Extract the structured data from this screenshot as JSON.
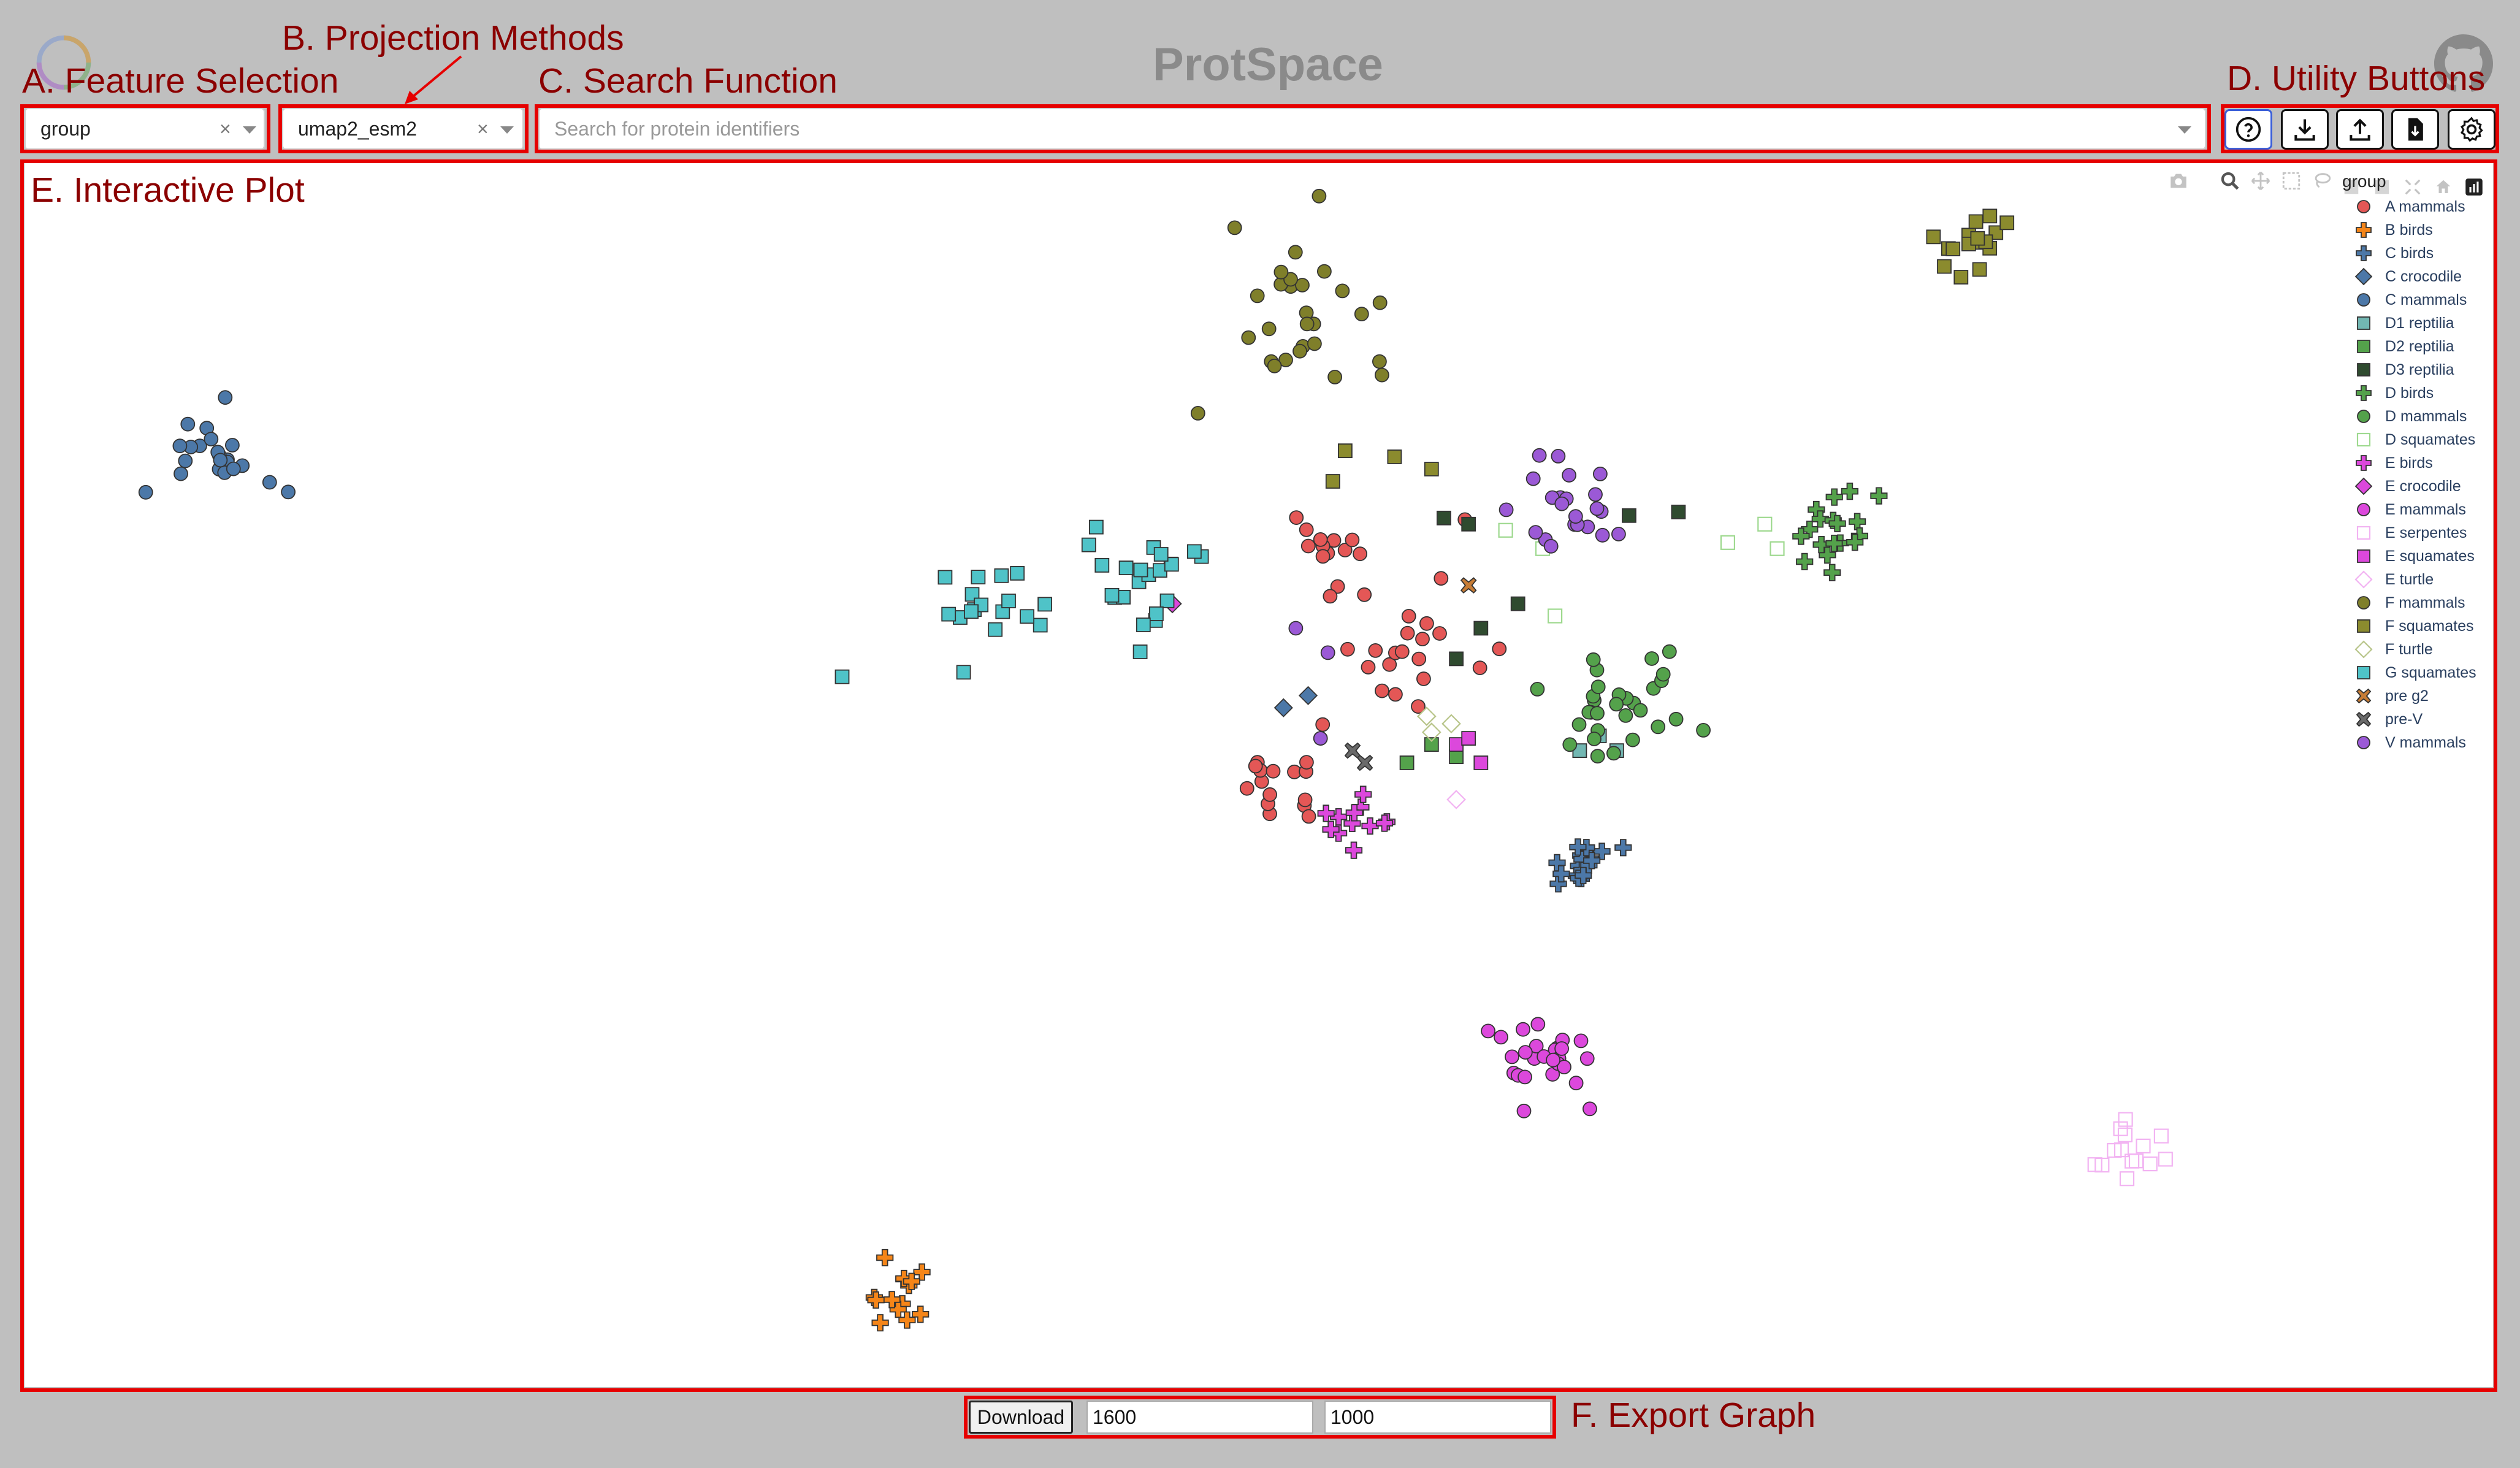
{
  "app_title": "ProtSpace",
  "annotations": {
    "a": "A. Feature Selection",
    "b": "B. Projection Methods",
    "c": "C. Search Function",
    "d": "D. Utility Buttons",
    "e": "E. Interactive Plot",
    "f": "F. Export Graph"
  },
  "feature_select": {
    "value": "group",
    "clear": "×"
  },
  "projection_select": {
    "value": "umap2_esm2",
    "clear": "×"
  },
  "search": {
    "placeholder": "Search for protein identifiers"
  },
  "utility_buttons": [
    "help-icon",
    "download-icon",
    "upload-icon",
    "file-download-icon",
    "gear-icon"
  ],
  "modebar_icons": [
    "camera-icon",
    "zoom-icon",
    "pan-icon",
    "box-select-icon",
    "lasso-icon",
    "zoom-in-icon",
    "zoom-out-icon",
    "autoscale-icon",
    "home-icon",
    "plotly-logo-icon"
  ],
  "export": {
    "button_label": "Download",
    "width": "1600",
    "height": "1000"
  },
  "chart_data": {
    "type": "scatter",
    "legend_title": "group",
    "legend_placement": "top-right",
    "xlim": [
      0,
      100
    ],
    "ylim": [
      0,
      100
    ],
    "series": [
      {
        "name": "A mammals",
        "color": "#e45756",
        "symbol": "circle",
        "fill": true,
        "cluster": [
          [
            53,
            70,
            2.5,
            12
          ],
          [
            56,
            60,
            3,
            22
          ],
          [
            51,
            50,
            2.5,
            16
          ]
        ]
      },
      {
        "name": "B birds",
        "color": "#f58518",
        "symbol": "cross",
        "fill": true,
        "cluster": [
          [
            35.2,
            7,
            1.2,
            14
          ]
        ]
      },
      {
        "name": "C birds",
        "color": "#4c78a8",
        "symbol": "cross",
        "fill": true,
        "cluster": [
          [
            63,
            42.5,
            1.3,
            18
          ]
        ]
      },
      {
        "name": "C crocodile",
        "color": "#4c78a8",
        "symbol": "diamond",
        "fill": true,
        "points": [
          [
            51,
            55.5
          ],
          [
            52,
            56.5
          ]
        ]
      },
      {
        "name": "C mammals",
        "color": "#4c78a8",
        "symbol": "circle",
        "fill": true,
        "cluster": [
          [
            7.5,
            76.5,
            2.5,
            22
          ]
        ]
      },
      {
        "name": "D1 reptilia",
        "color": "#72b7b2",
        "symbol": "square",
        "fill": true,
        "points": [
          [
            63,
            52
          ],
          [
            64.5,
            52
          ],
          [
            63.8,
            53.2
          ]
        ]
      },
      {
        "name": "D2 reptilia",
        "color": "#54a24b",
        "symbol": "square",
        "fill": true,
        "points": [
          [
            56,
            51
          ],
          [
            58,
            51.5
          ],
          [
            57,
            52.5
          ]
        ]
      },
      {
        "name": "D3 reptilia",
        "color": "#2f4b2f",
        "symbol": "square",
        "fill": true,
        "points": [
          [
            57.5,
            71
          ],
          [
            58.5,
            70.5
          ],
          [
            65,
            71.2
          ],
          [
            67,
            71.5
          ],
          [
            59,
            62
          ],
          [
            60.5,
            64
          ],
          [
            58,
            59.5
          ]
        ]
      },
      {
        "name": "D birds",
        "color": "#54a24b",
        "symbol": "cross",
        "fill": true,
        "cluster": [
          [
            73,
            69.5,
            2,
            18
          ]
        ]
      },
      {
        "name": "D mammals",
        "color": "#54a24b",
        "symbol": "circle",
        "fill": true,
        "cluster": [
          [
            65,
            56,
            3,
            30
          ]
        ]
      },
      {
        "name": "D squamates",
        "color": "#9ed98f",
        "symbol": "square",
        "fill": false,
        "points": [
          [
            60,
            70
          ],
          [
            61.5,
            68.5
          ],
          [
            69,
            69
          ],
          [
            70.5,
            70.5
          ],
          [
            71,
            68.5
          ],
          [
            62,
            63
          ]
        ]
      },
      {
        "name": "E birds",
        "color": "#dc48dc",
        "symbol": "cross",
        "fill": true,
        "cluster": [
          [
            54,
            46,
            1.5,
            12
          ]
        ]
      },
      {
        "name": "E crocodile",
        "color": "#dc48dc",
        "symbol": "diamond",
        "fill": true,
        "points": [
          [
            46.5,
            64
          ]
        ]
      },
      {
        "name": "E mammals",
        "color": "#dc48dc",
        "symbol": "circle",
        "fill": true,
        "cluster": [
          [
            61.5,
            27,
            2,
            26
          ]
        ]
      },
      {
        "name": "E serpentes",
        "color": "#f2b3f2",
        "symbol": "square",
        "fill": false,
        "cluster": [
          [
            85.5,
            19,
            1.3,
            14
          ]
        ]
      },
      {
        "name": "E squamates",
        "color": "#dc48dc",
        "symbol": "square",
        "fill": true,
        "points": [
          [
            58,
            52.5
          ],
          [
            59,
            51
          ],
          [
            58.5,
            53
          ]
        ]
      },
      {
        "name": "E turtle",
        "color": "#f2b3f2",
        "symbol": "diamond",
        "fill": false,
        "points": [
          [
            58,
            48
          ]
        ]
      },
      {
        "name": "F mammals",
        "color": "#7f7f2a",
        "symbol": "circle",
        "fill": true,
        "cluster": [
          [
            52,
            89,
            3,
            28
          ]
        ]
      },
      {
        "name": "F squamates",
        "color": "#8b8b2e",
        "symbol": "square",
        "fill": true,
        "cluster": [
          [
            78.8,
            93.5,
            1.5,
            16
          ]
        ],
        "points": [
          [
            53.5,
            76.5
          ],
          [
            55.5,
            76
          ],
          [
            57,
            75
          ],
          [
            53,
            74
          ]
        ]
      },
      {
        "name": "F turtle",
        "color": "#b8c58a",
        "symbol": "diamond",
        "fill": false,
        "points": [
          [
            57,
            53.5
          ],
          [
            57.8,
            54.2
          ],
          [
            56.8,
            54.8
          ]
        ]
      },
      {
        "name": "G squamates",
        "color": "#4fc3c8",
        "symbol": "square",
        "fill": true,
        "cluster": [
          [
            39,
            63.5,
            2.5,
            18
          ],
          [
            46,
            66,
            2.5,
            22
          ]
        ]
      },
      {
        "name": "pre g2",
        "color": "#c77c35",
        "symbol": "x",
        "fill": true,
        "points": [
          [
            58.5,
            65.5
          ]
        ]
      },
      {
        "name": "pre-V",
        "color": "#6a6a6a",
        "symbol": "x",
        "fill": true,
        "points": [
          [
            53.8,
            52
          ],
          [
            54.3,
            51
          ]
        ]
      },
      {
        "name": "V mammals",
        "color": "#9b59d6",
        "symbol": "circle",
        "fill": true,
        "cluster": [
          [
            62.5,
            72,
            2.3,
            22
          ]
        ],
        "points": [
          [
            51.5,
            62
          ],
          [
            52.8,
            60
          ],
          [
            52.5,
            53
          ]
        ]
      }
    ]
  }
}
